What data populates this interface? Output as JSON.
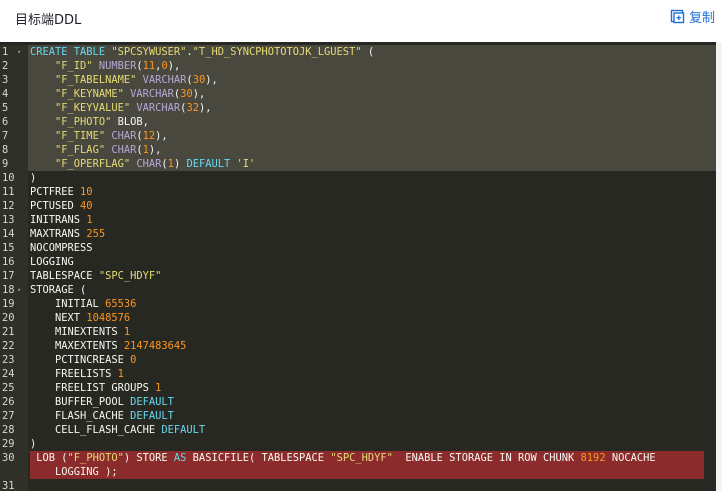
{
  "header": {
    "title": "目标端DDL",
    "copy_label": "复制"
  },
  "accent": "#1e6fd6",
  "editor": {
    "selected_lines": [
      1,
      2,
      3,
      4,
      5,
      6,
      7,
      8,
      9
    ],
    "highlighted_line": 30,
    "lines": [
      {
        "n": "1",
        "fold": true,
        "tokens": [
          [
            "kw",
            "CREATE TABLE "
          ],
          [
            "str",
            "\"SPCSYWUSER\""
          ],
          [
            "plain",
            "."
          ],
          [
            "str",
            "\"T_HD_SYNCPHOTOTOJK_LGUEST\""
          ],
          [
            "plain",
            " ("
          ]
        ]
      },
      {
        "n": "2",
        "tokens": [
          [
            "plain",
            "    "
          ],
          [
            "str",
            "\"F_ID\""
          ],
          [
            "plain",
            " "
          ],
          [
            "typ",
            "NUMBER"
          ],
          [
            "plain",
            "("
          ],
          [
            "num",
            "11"
          ],
          [
            "plain",
            ","
          ],
          [
            "num",
            "0"
          ],
          [
            "plain",
            "),"
          ]
        ]
      },
      {
        "n": "3",
        "tokens": [
          [
            "plain",
            "    "
          ],
          [
            "str",
            "\"F_TABELNAME\""
          ],
          [
            "plain",
            " "
          ],
          [
            "typ",
            "VARCHAR"
          ],
          [
            "plain",
            "("
          ],
          [
            "num",
            "30"
          ],
          [
            "plain",
            "),"
          ]
        ]
      },
      {
        "n": "4",
        "tokens": [
          [
            "plain",
            "    "
          ],
          [
            "str",
            "\"F_KEYNAME\""
          ],
          [
            "plain",
            " "
          ],
          [
            "typ",
            "VARCHAR"
          ],
          [
            "plain",
            "("
          ],
          [
            "num",
            "30"
          ],
          [
            "plain",
            "),"
          ]
        ]
      },
      {
        "n": "5",
        "tokens": [
          [
            "plain",
            "    "
          ],
          [
            "str",
            "\"F_KEYVALUE\""
          ],
          [
            "plain",
            " "
          ],
          [
            "typ",
            "VARCHAR"
          ],
          [
            "plain",
            "("
          ],
          [
            "num",
            "32"
          ],
          [
            "plain",
            "),"
          ]
        ]
      },
      {
        "n": "6",
        "tokens": [
          [
            "plain",
            "    "
          ],
          [
            "str",
            "\"F_PHOTO\""
          ],
          [
            "plain",
            " BLOB,"
          ]
        ]
      },
      {
        "n": "7",
        "tokens": [
          [
            "plain",
            "    "
          ],
          [
            "str",
            "\"F_TIME\""
          ],
          [
            "plain",
            " "
          ],
          [
            "typ",
            "CHAR"
          ],
          [
            "plain",
            "("
          ],
          [
            "num",
            "12"
          ],
          [
            "plain",
            "),"
          ]
        ]
      },
      {
        "n": "8",
        "tokens": [
          [
            "plain",
            "    "
          ],
          [
            "str",
            "\"F_FLAG\""
          ],
          [
            "plain",
            " "
          ],
          [
            "typ",
            "CHAR"
          ],
          [
            "plain",
            "("
          ],
          [
            "num",
            "1"
          ],
          [
            "plain",
            "),"
          ]
        ]
      },
      {
        "n": "9",
        "tokens": [
          [
            "plain",
            "    "
          ],
          [
            "str",
            "\"F_OPERFLAG\""
          ],
          [
            "plain",
            " "
          ],
          [
            "typ",
            "CHAR"
          ],
          [
            "plain",
            "("
          ],
          [
            "num",
            "1"
          ],
          [
            "plain",
            ") "
          ],
          [
            "kw",
            "DEFAULT "
          ],
          [
            "str",
            "'I'"
          ]
        ]
      },
      {
        "n": "10",
        "tokens": [
          [
            "plain",
            ")"
          ]
        ]
      },
      {
        "n": "11",
        "tokens": [
          [
            "plain",
            "PCTFREE "
          ],
          [
            "num",
            "10"
          ]
        ]
      },
      {
        "n": "12",
        "tokens": [
          [
            "plain",
            "PCTUSED "
          ],
          [
            "num",
            "40"
          ]
        ]
      },
      {
        "n": "13",
        "tokens": [
          [
            "plain",
            "INITRANS "
          ],
          [
            "num",
            "1"
          ]
        ]
      },
      {
        "n": "14",
        "tokens": [
          [
            "plain",
            "MAXTRANS "
          ],
          [
            "num",
            "255"
          ]
        ]
      },
      {
        "n": "15",
        "tokens": [
          [
            "plain",
            "NOCOMPRESS"
          ]
        ]
      },
      {
        "n": "16",
        "tokens": [
          [
            "plain",
            "LOGGING"
          ]
        ]
      },
      {
        "n": "17",
        "tokens": [
          [
            "plain",
            "TABLESPACE "
          ],
          [
            "str",
            "\"SPC_HDYF\""
          ]
        ]
      },
      {
        "n": "18",
        "fold": true,
        "tokens": [
          [
            "plain",
            "STORAGE ("
          ]
        ]
      },
      {
        "n": "19",
        "tokens": [
          [
            "plain",
            "    INITIAL "
          ],
          [
            "num",
            "65536"
          ]
        ]
      },
      {
        "n": "20",
        "tokens": [
          [
            "plain",
            "    NEXT "
          ],
          [
            "num",
            "1048576"
          ]
        ]
      },
      {
        "n": "21",
        "tokens": [
          [
            "plain",
            "    MINEXTENTS "
          ],
          [
            "num",
            "1"
          ]
        ]
      },
      {
        "n": "22",
        "tokens": [
          [
            "plain",
            "    MAXEXTENTS "
          ],
          [
            "num",
            "2147483645"
          ]
        ]
      },
      {
        "n": "23",
        "tokens": [
          [
            "plain",
            "    PCTINCREASE "
          ],
          [
            "num",
            "0"
          ]
        ]
      },
      {
        "n": "24",
        "tokens": [
          [
            "plain",
            "    FREELISTS "
          ],
          [
            "num",
            "1"
          ]
        ]
      },
      {
        "n": "25",
        "tokens": [
          [
            "plain",
            "    FREELIST GROUPS "
          ],
          [
            "num",
            "1"
          ]
        ]
      },
      {
        "n": "26",
        "tokens": [
          [
            "plain",
            "    BUFFER_POOL "
          ],
          [
            "kw",
            "DEFAULT"
          ]
        ]
      },
      {
        "n": "27",
        "tokens": [
          [
            "plain",
            "    FLASH_CACHE "
          ],
          [
            "kw",
            "DEFAULT"
          ]
        ]
      },
      {
        "n": "28",
        "tokens": [
          [
            "plain",
            "    CELL_FLASH_CACHE "
          ],
          [
            "kw",
            "DEFAULT"
          ]
        ]
      },
      {
        "n": "29",
        "tokens": [
          [
            "plain",
            ")"
          ]
        ]
      },
      {
        "n": "30",
        "tokens": [
          [
            "plain",
            " LOB ("
          ],
          [
            "str",
            "\"F_PHOTO\""
          ],
          [
            "plain",
            ") STORE "
          ],
          [
            "kw",
            "AS"
          ],
          [
            "plain",
            " BASICFILE( TABLESPACE "
          ],
          [
            "str",
            "\"SPC_HDYF\""
          ],
          [
            "plain",
            "  ENABLE STORAGE IN ROW CHUNK "
          ],
          [
            "num",
            "8192"
          ],
          [
            "plain",
            " NOCACHE"
          ]
        ]
      },
      {
        "n": "",
        "cont": true,
        "tokens": [
          [
            "plain",
            "    LOGGING );"
          ]
        ]
      },
      {
        "n": "31",
        "tokens": []
      }
    ]
  }
}
